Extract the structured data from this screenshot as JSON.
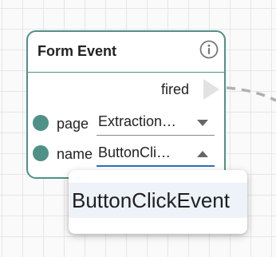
{
  "node": {
    "title": "Form Event",
    "output_label": "fired",
    "fields": [
      {
        "label": "page",
        "value": "Extraction…"
      },
      {
        "label": "name",
        "value": "ButtonCli…"
      }
    ]
  },
  "dropdown": {
    "options": [
      "ButtonClickEvent"
    ]
  },
  "icons": {
    "info": "info-icon",
    "output_port": "triangle-right-icon",
    "caret_down": "caret-down-icon",
    "caret_up": "caret-up-icon"
  },
  "colors": {
    "node_border": "#4f9186",
    "port": "#4f9186",
    "focus_underline": "#2f6fb7",
    "edge": "#b0b0b0",
    "option_highlight": "#eef2f9"
  }
}
